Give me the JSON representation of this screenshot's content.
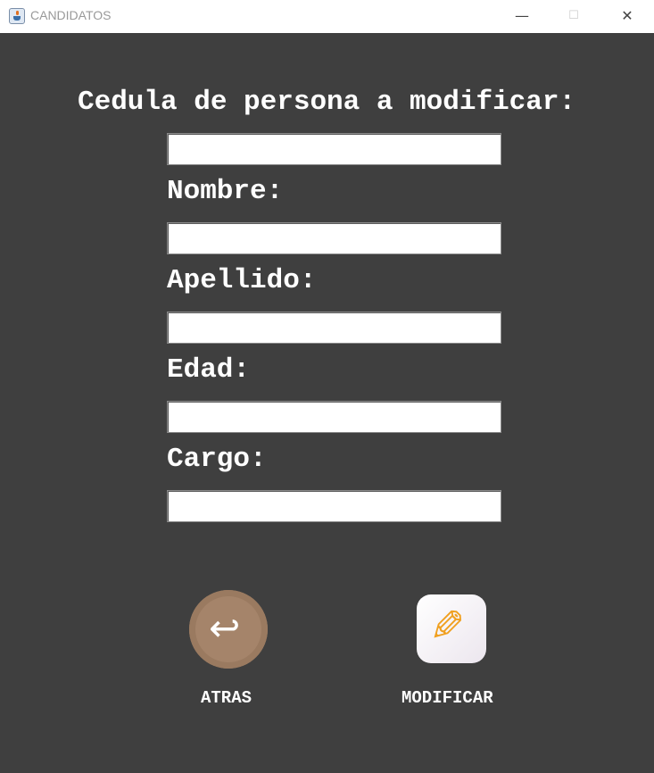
{
  "window": {
    "title": "CANDIDATOS",
    "minimize": "—",
    "maximize": "☐",
    "close": "✕"
  },
  "form": {
    "cedula_label": "Cedula de persona a modificar:",
    "nombre_label": "Nombre:",
    "apellido_label": "Apellido:",
    "edad_label": "Edad:",
    "cargo_label": "Cargo:",
    "cedula_value": "",
    "nombre_value": "",
    "apellido_value": "",
    "edad_value": "",
    "cargo_value": ""
  },
  "buttons": {
    "back_label": "ATRAS",
    "back_icon": "back-arrow-icon",
    "modify_label": "MODIFICAR",
    "modify_icon": "pencil-icon"
  }
}
